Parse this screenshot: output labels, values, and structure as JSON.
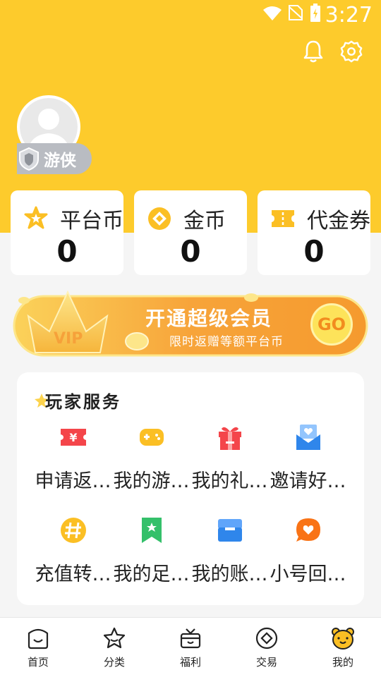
{
  "status_bar": {
    "time": "3:27"
  },
  "profile": {
    "level_label": "游侠"
  },
  "stats": [
    {
      "label": "平台币",
      "value": "0",
      "icon": "star-badge-icon"
    },
    {
      "label": "金币",
      "value": "0",
      "icon": "gold-coin-icon"
    },
    {
      "label": "代金券",
      "value": "0",
      "icon": "voucher-icon"
    }
  ],
  "vip_banner": {
    "badge": "VIP",
    "title": "开通超级会员",
    "subtitle": "限时返赠等额平台币",
    "button": "GO"
  },
  "services": {
    "title": "玩家服务",
    "items": [
      {
        "label": "申请返…",
        "icon": "rebate-ticket-icon"
      },
      {
        "label": "我的游…",
        "icon": "gamepad-icon"
      },
      {
        "label": "我的礼…",
        "icon": "gift-icon"
      },
      {
        "label": "邀请好…",
        "icon": "invite-mail-icon"
      },
      {
        "label": "充值转…",
        "icon": "hash-coin-icon"
      },
      {
        "label": "我的足…",
        "icon": "bookmark-icon"
      },
      {
        "label": "我的账…",
        "icon": "account-box-icon"
      },
      {
        "label": "小号回…",
        "icon": "chat-heart-icon"
      }
    ]
  },
  "nav": [
    {
      "label": "首页",
      "icon": "home-icon"
    },
    {
      "label": "分类",
      "icon": "category-star-icon"
    },
    {
      "label": "福利",
      "icon": "gift-box-icon"
    },
    {
      "label": "交易",
      "icon": "trade-coin-icon"
    },
    {
      "label": "我的",
      "icon": "bear-face-icon"
    }
  ],
  "colors": {
    "header": "#fdcb2c",
    "accent_orange": "#f28c1e",
    "red": "#f4454a",
    "yellow": "#fbbf24",
    "blue": "#2f86eb"
  }
}
